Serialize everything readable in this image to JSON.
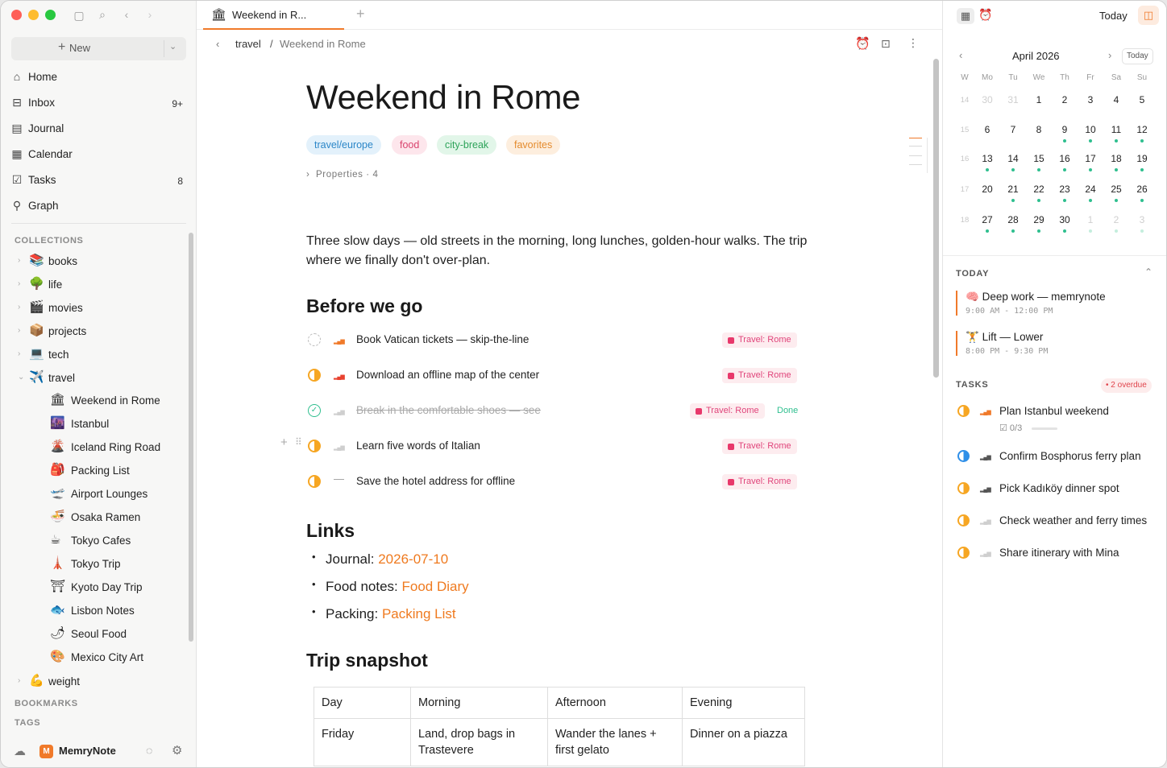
{
  "sidebar": {
    "new_label": "New",
    "nav": [
      {
        "label": "Home",
        "icon": "home-icon",
        "glyph": "⌂",
        "count": ""
      },
      {
        "label": "Inbox",
        "icon": "inbox-icon",
        "glyph": "⊟",
        "count": "9+"
      },
      {
        "label": "Journal",
        "icon": "journal-icon",
        "glyph": "▤",
        "count": ""
      },
      {
        "label": "Calendar",
        "icon": "calendar-icon",
        "glyph": "▦",
        "count": ""
      },
      {
        "label": "Tasks",
        "icon": "tasks-icon",
        "glyph": "☑",
        "count": "8"
      },
      {
        "label": "Graph",
        "icon": "graph-icon",
        "glyph": "⚲",
        "count": ""
      }
    ],
    "collections_label": "COLLECTIONS",
    "collections": [
      {
        "label": "books",
        "emoji": "📚"
      },
      {
        "label": "life",
        "emoji": "🌳"
      },
      {
        "label": "movies",
        "emoji": "🎬"
      },
      {
        "label": "projects",
        "emoji": "📦"
      },
      {
        "label": "tech",
        "emoji": "💻"
      },
      {
        "label": "travel",
        "emoji": "✈️"
      }
    ],
    "travel_items": [
      {
        "label": "Weekend in Rome",
        "emoji": "🏛"
      },
      {
        "label": "Istanbul",
        "emoji": "🌆"
      },
      {
        "label": "Iceland Ring Road",
        "emoji": "🌋"
      },
      {
        "label": "Packing List",
        "emoji": "🎒"
      },
      {
        "label": "Airport Lounges",
        "emoji": "🛫"
      },
      {
        "label": "Osaka Ramen",
        "emoji": "🍜"
      },
      {
        "label": "Tokyo Cafes",
        "emoji": "☕"
      },
      {
        "label": "Tokyo Trip",
        "emoji": "🗼"
      },
      {
        "label": "Kyoto Day Trip",
        "emoji": "⛩"
      },
      {
        "label": "Lisbon Notes",
        "emoji": "🐟"
      },
      {
        "label": "Seoul Food",
        "emoji": "🌶"
      },
      {
        "label": "Mexico City Art",
        "emoji": "🎨"
      }
    ],
    "weight": {
      "label": "weight",
      "emoji": "💪"
    },
    "bookmarks_label": "BOOKMARKS",
    "tags_label": "TAGS",
    "brand": "MemryNote",
    "brand_initial": "M"
  },
  "tab": {
    "title": "Weekend in R...",
    "emoji": "🏛"
  },
  "breadcrumb": {
    "parent": "travel",
    "sep": "/",
    "current": "Weekend in Rome"
  },
  "note": {
    "title": "Weekend in Rome",
    "tags": [
      {
        "label": "travel/europe",
        "bg": "#e3f1fb",
        "fg": "#2b86c8"
      },
      {
        "label": "food",
        "bg": "#fde6ec",
        "fg": "#d9426d"
      },
      {
        "label": "city-break",
        "bg": "#e2f6e9",
        "fg": "#2ea35a"
      },
      {
        "label": "favorites",
        "bg": "#fdeede",
        "fg": "#e48a2c"
      }
    ],
    "properties": "Properties",
    "properties_count": "· 4",
    "intro": "Three slow days — old streets in the morning, long lunches, golden-hour walks. The trip where we finally don't over-plan.",
    "before_heading": "Before we go",
    "tasks": [
      {
        "text": "Book Vatican tickets — skip-the-line",
        "tag": "Travel: Rome",
        "status": "todo",
        "prio": "high",
        "extra": ""
      },
      {
        "text": "Download an offline map of the center",
        "tag": "Travel: Rome",
        "status": "progress",
        "prio": "urgent",
        "extra": ""
      },
      {
        "text": "Break in the comfortable shoes — see",
        "tag": "Travel: Rome",
        "status": "done",
        "prio": "low",
        "extra": "Done"
      },
      {
        "text": "Learn five words of Italian",
        "tag": "Travel: Rome",
        "status": "progress",
        "prio": "none",
        "extra": ""
      },
      {
        "text": "Save the hotel address for offline",
        "tag": "Travel: Rome",
        "status": "progress",
        "prio": "dash",
        "extra": ""
      }
    ],
    "links_heading": "Links",
    "links": [
      {
        "label": "Journal:",
        "value": "2026-07-10"
      },
      {
        "label": "Food notes:",
        "value": "Food Diary"
      },
      {
        "label": "Packing:",
        "value": "Packing List"
      }
    ],
    "snapshot_heading": "Trip snapshot",
    "table": {
      "headers": [
        "Day",
        "Morning",
        "Afternoon",
        "Evening"
      ],
      "rows": [
        [
          "Friday",
          "Land, drop bags in Trastevere",
          "Wander the lanes + first gelato",
          "Dinner on a piazza"
        ]
      ]
    }
  },
  "right": {
    "today_button": "Today",
    "month": "April 2026",
    "today_chip": "Today",
    "weekday_headers": [
      "W",
      "Mo",
      "Tu",
      "We",
      "Th",
      "Fr",
      "Sa",
      "Su"
    ],
    "weeks": [
      {
        "wk": "14",
        "days": [
          "30",
          "31",
          "1",
          "2",
          "3",
          "4",
          "5"
        ]
      },
      {
        "wk": "15",
        "days": [
          "6",
          "7",
          "8",
          "9",
          "10",
          "11",
          "12"
        ]
      },
      {
        "wk": "16",
        "days": [
          "13",
          "14",
          "15",
          "16",
          "17",
          "18",
          "19"
        ]
      },
      {
        "wk": "17",
        "days": [
          "20",
          "21",
          "22",
          "23",
          "24",
          "25",
          "26"
        ]
      },
      {
        "wk": "18",
        "days": [
          "27",
          "28",
          "29",
          "30",
          "1",
          "2",
          "3"
        ]
      }
    ],
    "today_label": "TODAY",
    "events": [
      {
        "title": "Deep work — memrynote",
        "emoji": "🧠",
        "time": "9:00 AM - 12:00 PM"
      },
      {
        "title": "Lift — Lower",
        "emoji": "🏋",
        "time": "8:00 PM - 9:30 PM"
      }
    ],
    "tasks_label": "TASKS",
    "overdue": "2 overdue",
    "tasks": [
      {
        "text": "Plan Istanbul weekend",
        "status": "progress",
        "sub": "0/3"
      },
      {
        "text": "Confirm Bosphorus ferry plan",
        "status": "progress-blue",
        "sub": ""
      },
      {
        "text": "Pick Kadıköy dinner spot",
        "status": "progress",
        "sub": ""
      },
      {
        "text": "Check weather and ferry times",
        "status": "progress",
        "sub": ""
      },
      {
        "text": "Share itinerary with Mina",
        "status": "progress",
        "sub": ""
      }
    ]
  },
  "colors": {
    "accent": "#f07a2a",
    "tag_pink": "#e8386b",
    "done_green": "#2fbf8f"
  }
}
